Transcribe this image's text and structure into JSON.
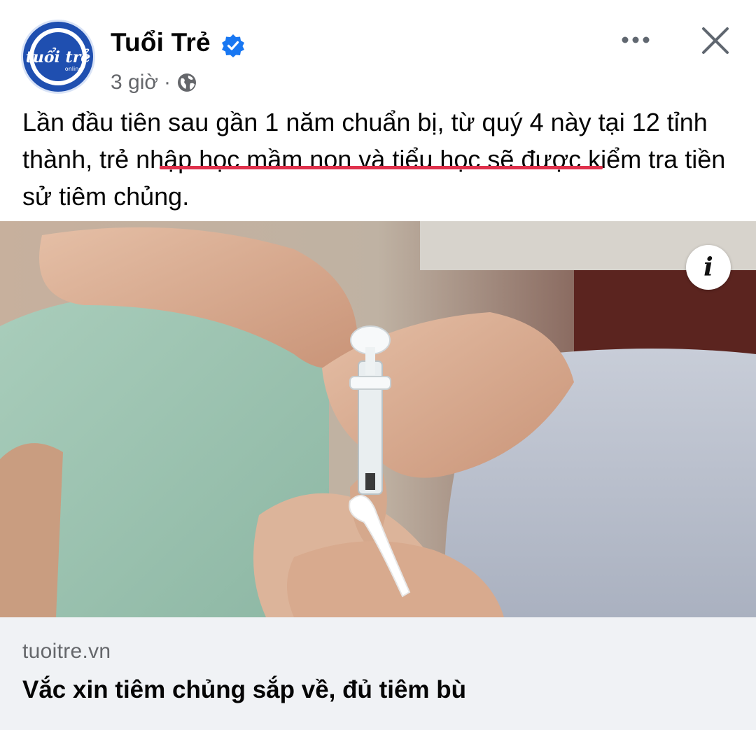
{
  "post": {
    "page_name": "Tuổi Trẻ",
    "time": "3 giờ",
    "separator": "·",
    "verified_icon": "verified-badge-icon",
    "more_icon": "more-options-icon",
    "close_icon": "close-icon",
    "caption_before": "Lần đầu tiên sau gần 1 năm chuẩn bị, từ quý 4 này tại 12 tỉnh thành, ",
    "caption_highlight": "trẻ nhập học mầm non và tiểu học",
    "caption_after": " sẽ được kiểm tra tiền sử tiêm chủng.",
    "highlight_color": "#e0314c",
    "avatar": {
      "logo_text": "tuổi trẻ",
      "logo_subtext": "online",
      "color": "#1f4fb0"
    }
  },
  "image": {
    "description_icon": "info-icon",
    "info_label": "i"
  },
  "link_card": {
    "domain": "tuoitre.vn",
    "title": "Vắc xin tiêm chủng sắp về, đủ tiêm bù"
  }
}
